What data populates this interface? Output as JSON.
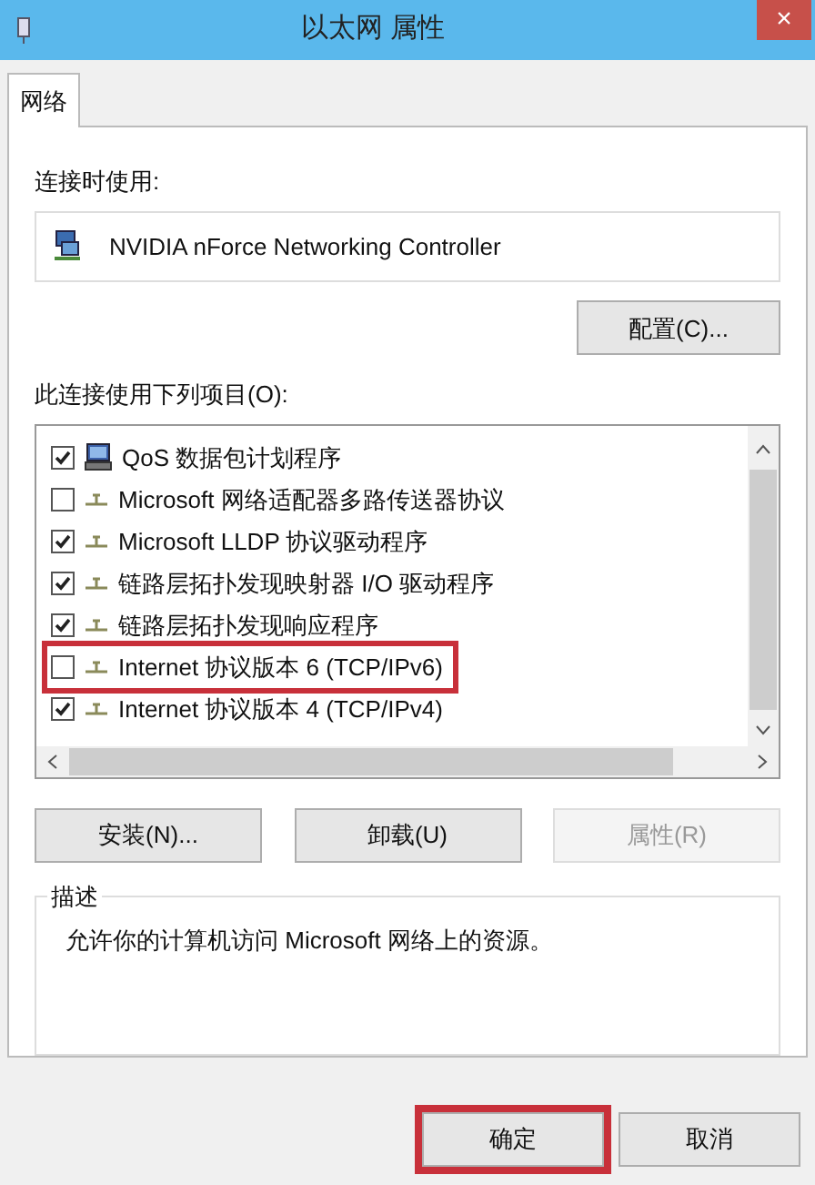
{
  "window": {
    "title": "以太网 属性",
    "close": "×"
  },
  "tabs": [
    {
      "label": "网络",
      "selected": true
    }
  ],
  "connect_using": {
    "label": "连接时使用:",
    "adapter": "NVIDIA nForce Networking Controller",
    "configure_button": "配置(C)..."
  },
  "items_label": "此连接使用下列项目(O):",
  "items": [
    {
      "kind": "service",
      "label": "QoS 数据包计划程序",
      "checked": true,
      "highlighted": false
    },
    {
      "kind": "protocol",
      "label": "Microsoft 网络适配器多路传送器协议",
      "checked": false,
      "highlighted": false
    },
    {
      "kind": "protocol",
      "label": "Microsoft LLDP 协议驱动程序",
      "checked": true,
      "highlighted": false
    },
    {
      "kind": "protocol",
      "label": "链路层拓扑发现映射器 I/O 驱动程序",
      "checked": true,
      "highlighted": false
    },
    {
      "kind": "protocol",
      "label": "链路层拓扑发现响应程序",
      "checked": true,
      "highlighted": false
    },
    {
      "kind": "protocol",
      "label": "Internet 协议版本 6 (TCP/IPv6)",
      "checked": false,
      "highlighted": true
    },
    {
      "kind": "protocol",
      "label": "Internet 协议版本 4 (TCP/IPv4)",
      "checked": true,
      "highlighted": false
    }
  ],
  "item_buttons": [
    {
      "label": "安装(N)...",
      "disabled": false
    },
    {
      "label": "卸载(U)",
      "disabled": false
    },
    {
      "label": "属性(R)",
      "disabled": true
    }
  ],
  "description": {
    "title": "描述",
    "text": "允许你的计算机访问 Microsoft 网络上的资源。"
  },
  "footer_buttons": [
    {
      "label": "确定",
      "highlighted": true
    },
    {
      "label": "取消",
      "highlighted": false
    }
  ]
}
